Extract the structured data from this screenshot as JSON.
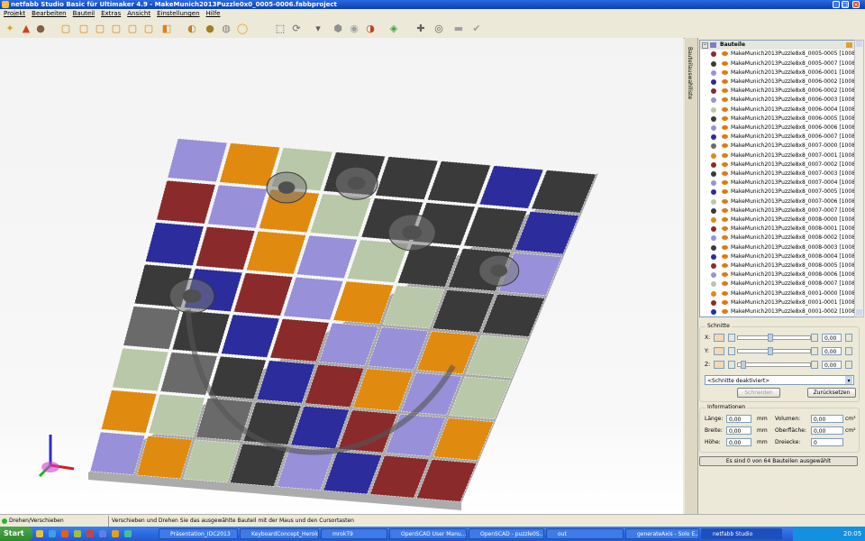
{
  "window": {
    "title": "netfabb Studio Basic für Ultimaker 4.9 - MakeMunich2013Puzzle0x0_0005-0006.fabbproject"
  },
  "menu": [
    "Projekt",
    "Bearbeiten",
    "Bauteil",
    "Extras",
    "Ansicht",
    "Einstellungen",
    "Hilfe"
  ],
  "toolbar": {
    "icons": [
      "new-icon",
      "open-icon",
      "save-icon",
      "view-front-icon",
      "view-back-icon",
      "view-left-icon",
      "view-right-icon",
      "view-top-icon",
      "view-bottom-icon",
      "view-iso-icon",
      "shading-icon",
      "solid-icon",
      "wireframe-icon",
      "zoom-icon",
      "select-icon",
      "rotate-icon",
      "measure-icon",
      "repair-icon",
      "analysis-icon",
      "slice-icon",
      "support-icon",
      "add-icon",
      "cut-icon",
      "minus-icon",
      "check-icon"
    ]
  },
  "side_tab": {
    "label": "Bauteilauswahlliste"
  },
  "parts": {
    "header": "Bauteile",
    "items": [
      {
        "label": "MakeMunich2013Puzzle8x8_0005-0005 [1008]",
        "color": "#8a2a2a"
      },
      {
        "label": "MakeMunich2013Puzzle8x8_0005-0007 [1008]",
        "color": "#3a3a3a"
      },
      {
        "label": "MakeMunich2013Puzzle8x8_0006-0001 [1008]",
        "color": "#9890d8"
      },
      {
        "label": "MakeMunich2013Puzzle8x8_0006-0002 [1008]",
        "color": "#2c2c9c"
      },
      {
        "label": "MakeMunich2013Puzzle8x8_0006-0002 [1008]",
        "color": "#8a2a2a"
      },
      {
        "label": "MakeMunich2013Puzzle8x8_0006-0003 [1008]",
        "color": "#9890d8"
      },
      {
        "label": "MakeMunich2013Puzzle8x8_0006-0004 [1008]",
        "color": "#b8c8a8"
      },
      {
        "label": "MakeMunich2013Puzzle8x8_0006-0005 [1008]",
        "color": "#3a3a3a"
      },
      {
        "label": "MakeMunich2013Puzzle8x8_0006-0006 [1008]",
        "color": "#9890d8"
      },
      {
        "label": "MakeMunich2013Puzzle8x8_0006-0007 [1008]",
        "color": "#2c2c9c"
      },
      {
        "label": "MakeMunich2013Puzzle8x8_0007-0000 [1008]",
        "color": "#6a6a6a"
      },
      {
        "label": "MakeMunich2013Puzzle8x8_0007-0001 [1008]",
        "color": "#e08a10"
      },
      {
        "label": "MakeMunich2013Puzzle8x8_0007-0002 [1008]",
        "color": "#8a2a2a"
      },
      {
        "label": "MakeMunich2013Puzzle8x8_0007-0003 [1008]",
        "color": "#3a3a3a"
      },
      {
        "label": "MakeMunich2013Puzzle8x8_0007-0004 [1008]",
        "color": "#9890d8"
      },
      {
        "label": "MakeMunich2013Puzzle8x8_0007-0005 [1008]",
        "color": "#2c2c9c"
      },
      {
        "label": "MakeMunich2013Puzzle8x8_0007-0006 [1008]",
        "color": "#b8c8a8"
      },
      {
        "label": "MakeMunich2013Puzzle8x8_0007-0007 [1008]",
        "color": "#3a3a3a"
      },
      {
        "label": "MakeMunich2013Puzzle8x8_0008-0000 [1008]",
        "color": "#e08a10"
      },
      {
        "label": "MakeMunich2013Puzzle8x8_0008-0001 [1008]",
        "color": "#8a2a2a"
      },
      {
        "label": "MakeMunich2013Puzzle8x8_0008-0002 [1008]",
        "color": "#9890d8"
      },
      {
        "label": "MakeMunich2013Puzzle8x8_0008-0003 [1008]",
        "color": "#3a3a3a"
      },
      {
        "label": "MakeMunich2013Puzzle8x8_0008-0004 [1008]",
        "color": "#2c2c9c"
      },
      {
        "label": "MakeMunich2013Puzzle8x8_0008-0005 [1008]",
        "color": "#8a2a2a"
      },
      {
        "label": "MakeMunich2013Puzzle8x8_0008-0006 [1008]",
        "color": "#9890d8"
      },
      {
        "label": "MakeMunich2013Puzzle8x8_0008-0007 [1008]",
        "color": "#b8c8a8"
      },
      {
        "label": "MakeMunich2013Puzzle8x8_0001-0000 [1008]",
        "color": "#e08a10"
      },
      {
        "label": "MakeMunich2013Puzzle8x8_0001-0001 [1008]",
        "color": "#8a2a2a"
      },
      {
        "label": "MakeMunich2013Puzzle8x8_0001-0002 [1008]",
        "color": "#2c2c9c"
      }
    ]
  },
  "schnitte": {
    "title": "Schnitte",
    "axes": [
      {
        "label": "X:",
        "value": "0,00"
      },
      {
        "label": "Y:",
        "value": "0,00"
      },
      {
        "label": "Z:",
        "value": "0,00"
      }
    ],
    "dropdown": "<Schnitte deaktiviert>",
    "cut_button": "Schneiden",
    "reset_button": "Zurücksetzen"
  },
  "info": {
    "title": "Informationen",
    "fields": [
      {
        "label": "Länge:",
        "value": "0,00",
        "unit": "mm",
        "label2": "Volumen:",
        "value2": "0,00",
        "unit2": "cm³"
      },
      {
        "label": "Breite:",
        "value": "0,00",
        "unit": "mm",
        "label2": "Oberfläche:",
        "value2": "0,00",
        "unit2": "cm²"
      },
      {
        "label": "Höhe:",
        "value": "0,00",
        "unit": "mm",
        "label2": "Dreiecke:",
        "value2": "0",
        "unit2": ""
      }
    ],
    "selection_text": "Es sind 0 von 64 Bauteilen ausgewählt"
  },
  "status": {
    "left": "Drehen/Verschieben",
    "center": "Verschieben und Drehen Sie das ausgewählte Bauteil mit der Maus und den Cursortasten"
  },
  "taskbar": {
    "start": "Start",
    "tasks": [
      {
        "label": "Präsentation_IDC2013",
        "active": false
      },
      {
        "label": "KeyboardConcept_Herold",
        "active": false
      },
      {
        "label": "mrokT9",
        "active": false
      },
      {
        "label": "OpenSCAD User Manu...",
        "active": false
      },
      {
        "label": "OpenSCAD - puzzle0S...",
        "active": false
      },
      {
        "label": "out",
        "active": false
      },
      {
        "label": "generateAxis - Solo E...",
        "active": false
      },
      {
        "label": "netfabb Studio",
        "active": true
      }
    ],
    "clock": "20:05"
  },
  "colors": {
    "orange": "#e08a10",
    "lavender": "#9890d8",
    "maroon": "#8a2a2a",
    "blue": "#2c2c9c",
    "black": "#3a3a3a",
    "sage": "#b8c8a8",
    "gray": "#6a6a6a"
  }
}
